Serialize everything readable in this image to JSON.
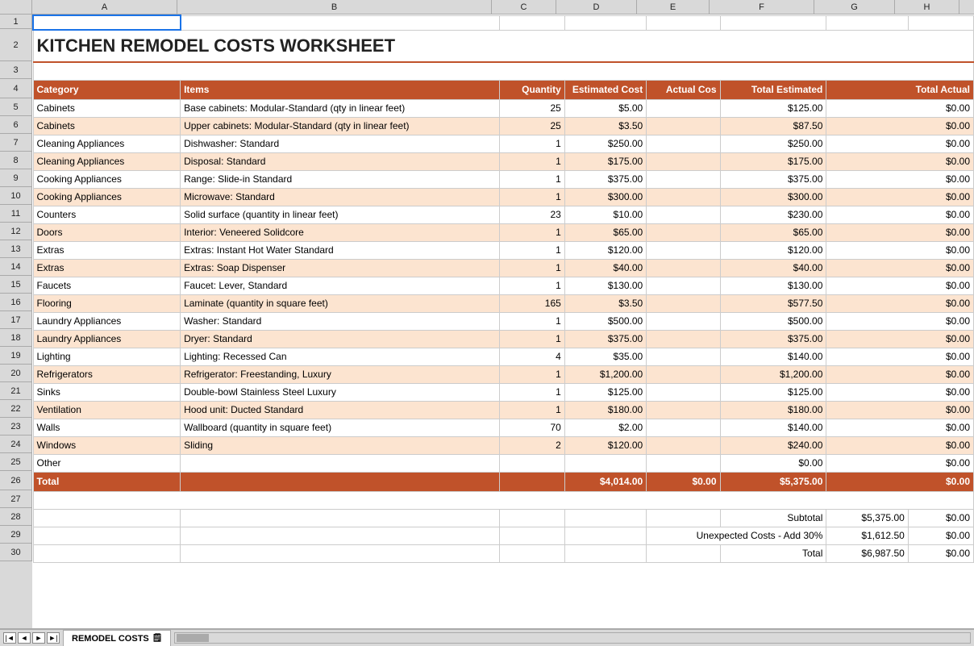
{
  "title": "KITCHEN REMODEL COSTS WORKSHEET",
  "sheetTab": "REMODEL COSTS",
  "columns": {
    "headers": [
      "A",
      "B",
      "C",
      "D",
      "E",
      "F",
      "G",
      "H"
    ]
  },
  "header_row": {
    "category": "Category",
    "items": "Items",
    "quantity": "Quantity",
    "estimated_cost": "Estimated Cost",
    "actual_cost": "Actual Cos",
    "total_estimated": "Total Estimated",
    "total_actual": "Total Actual"
  },
  "rows": [
    {
      "category": "Cabinets",
      "items": "Base cabinets: Modular-Standard (qty in linear feet)",
      "quantity": "25",
      "estimated_cost": "$5.00",
      "actual_cost": "",
      "total_estimated": "$125.00",
      "total_actual": "$0.00"
    },
    {
      "category": "Cabinets",
      "items": "Upper cabinets: Modular-Standard (qty in linear feet)",
      "quantity": "25",
      "estimated_cost": "$3.50",
      "actual_cost": "",
      "total_estimated": "$87.50",
      "total_actual": "$0.00"
    },
    {
      "category": "Cleaning Appliances",
      "items": "Dishwasher: Standard",
      "quantity": "1",
      "estimated_cost": "$250.00",
      "actual_cost": "",
      "total_estimated": "$250.00",
      "total_actual": "$0.00"
    },
    {
      "category": "Cleaning Appliances",
      "items": "Disposal: Standard",
      "quantity": "1",
      "estimated_cost": "$175.00",
      "actual_cost": "",
      "total_estimated": "$175.00",
      "total_actual": "$0.00"
    },
    {
      "category": "Cooking Appliances",
      "items": "Range: Slide-in Standard",
      "quantity": "1",
      "estimated_cost": "$375.00",
      "actual_cost": "",
      "total_estimated": "$375.00",
      "total_actual": "$0.00"
    },
    {
      "category": "Cooking Appliances",
      "items": "Microwave: Standard",
      "quantity": "1",
      "estimated_cost": "$300.00",
      "actual_cost": "",
      "total_estimated": "$300.00",
      "total_actual": "$0.00"
    },
    {
      "category": "Counters",
      "items": "Solid surface (quantity in linear feet)",
      "quantity": "23",
      "estimated_cost": "$10.00",
      "actual_cost": "",
      "total_estimated": "$230.00",
      "total_actual": "$0.00"
    },
    {
      "category": "Doors",
      "items": "Interior: Veneered Solidcore",
      "quantity": "1",
      "estimated_cost": "$65.00",
      "actual_cost": "",
      "total_estimated": "$65.00",
      "total_actual": "$0.00"
    },
    {
      "category": "Extras",
      "items": "Extras: Instant Hot Water Standard",
      "quantity": "1",
      "estimated_cost": "$120.00",
      "actual_cost": "",
      "total_estimated": "$120.00",
      "total_actual": "$0.00"
    },
    {
      "category": "Extras",
      "items": "Extras: Soap Dispenser",
      "quantity": "1",
      "estimated_cost": "$40.00",
      "actual_cost": "",
      "total_estimated": "$40.00",
      "total_actual": "$0.00"
    },
    {
      "category": "Faucets",
      "items": "Faucet: Lever, Standard",
      "quantity": "1",
      "estimated_cost": "$130.00",
      "actual_cost": "",
      "total_estimated": "$130.00",
      "total_actual": "$0.00"
    },
    {
      "category": "Flooring",
      "items": "Laminate (quantity in square feet)",
      "quantity": "165",
      "estimated_cost": "$3.50",
      "actual_cost": "",
      "total_estimated": "$577.50",
      "total_actual": "$0.00"
    },
    {
      "category": "Laundry Appliances",
      "items": "Washer: Standard",
      "quantity": "1",
      "estimated_cost": "$500.00",
      "actual_cost": "",
      "total_estimated": "$500.00",
      "total_actual": "$0.00"
    },
    {
      "category": "Laundry Appliances",
      "items": "Dryer: Standard",
      "quantity": "1",
      "estimated_cost": "$375.00",
      "actual_cost": "",
      "total_estimated": "$375.00",
      "total_actual": "$0.00"
    },
    {
      "category": "Lighting",
      "items": "Lighting: Recessed Can",
      "quantity": "4",
      "estimated_cost": "$35.00",
      "actual_cost": "",
      "total_estimated": "$140.00",
      "total_actual": "$0.00"
    },
    {
      "category": "Refrigerators",
      "items": "Refrigerator: Freestanding, Luxury",
      "quantity": "1",
      "estimated_cost": "$1,200.00",
      "actual_cost": "",
      "total_estimated": "$1,200.00",
      "total_actual": "$0.00"
    },
    {
      "category": "Sinks",
      "items": "Double-bowl Stainless Steel Luxury",
      "quantity": "1",
      "estimated_cost": "$125.00",
      "actual_cost": "",
      "total_estimated": "$125.00",
      "total_actual": "$0.00"
    },
    {
      "category": "Ventilation",
      "items": "Hood unit: Ducted Standard",
      "quantity": "1",
      "estimated_cost": "$180.00",
      "actual_cost": "",
      "total_estimated": "$180.00",
      "total_actual": "$0.00"
    },
    {
      "category": "Walls",
      "items": "Wallboard (quantity in square feet)",
      "quantity": "70",
      "estimated_cost": "$2.00",
      "actual_cost": "",
      "total_estimated": "$140.00",
      "total_actual": "$0.00"
    },
    {
      "category": "Windows",
      "items": "Sliding",
      "quantity": "2",
      "estimated_cost": "$120.00",
      "actual_cost": "",
      "total_estimated": "$240.00",
      "total_actual": "$0.00"
    },
    {
      "category": "Other",
      "items": "",
      "quantity": "",
      "estimated_cost": "",
      "actual_cost": "",
      "total_estimated": "$0.00",
      "total_actual": "$0.00"
    }
  ],
  "total_row": {
    "label": "Total",
    "estimated_cost": "$4,014.00",
    "actual_cost": "$0.00",
    "total_estimated": "$5,375.00",
    "total_actual": "$0.00"
  },
  "summary": {
    "subtotal_label": "Subtotal",
    "subtotal_estimated": "$5,375.00",
    "subtotal_actual": "$0.00",
    "unexpected_label": "Unexpected Costs - Add 30%",
    "unexpected_estimated": "$1,612.50",
    "unexpected_actual": "$0.00",
    "total_label": "Total",
    "total_estimated": "$6,987.50",
    "total_actual": "$0.00"
  },
  "row_numbers": [
    "1",
    "2",
    "3",
    "4",
    "5",
    "6",
    "7",
    "8",
    "9",
    "10",
    "11",
    "12",
    "13",
    "14",
    "15",
    "16",
    "17",
    "18",
    "19",
    "20",
    "21",
    "22",
    "23",
    "24",
    "25",
    "26",
    "27",
    "28",
    "29",
    "30"
  ]
}
